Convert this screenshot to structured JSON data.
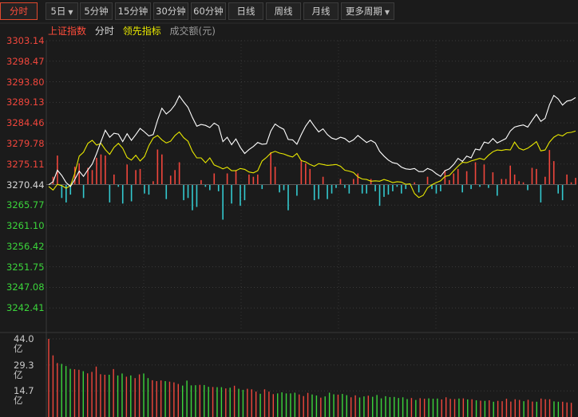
{
  "tabs": [
    {
      "label": "分时",
      "active": true
    },
    {
      "label": "5日",
      "dropdown": true
    },
    {
      "label": "5分钟"
    },
    {
      "label": "15分钟"
    },
    {
      "label": "30分钟"
    },
    {
      "label": "60分钟"
    },
    {
      "label": "日线"
    },
    {
      "label": "周线"
    },
    {
      "label": "月线"
    },
    {
      "label": "更多周期",
      "dropdown": true
    }
  ],
  "legend": {
    "index_name": "上证指数",
    "period": "分时",
    "indicator": "领先指标",
    "volume_label": "成交额(元)"
  },
  "colors": {
    "up": "#f0463c",
    "down": "#33c9cf",
    "price_line": "#ffffff",
    "avg_line": "#e8e800",
    "axis_up": "#f0463c",
    "axis_down": "#3bd53b",
    "active_tab": "#ff4c3b"
  },
  "chart_data": {
    "type": "line",
    "price_axis": {
      "labels": [
        "3303.14",
        "3298.47",
        "3293.80",
        "3289.13",
        "3284.46",
        "3279.78",
        "3275.11",
        "3270.44",
        "3265.77",
        "3261.10",
        "3256.42",
        "3251.75",
        "3247.08",
        "3242.41"
      ],
      "prev_close": "3270.44",
      "ylim": [
        3237.74,
        3303.14
      ]
    },
    "volume_axis": {
      "labels": [
        "44.0亿",
        "29.3亿",
        "14.7亿"
      ],
      "ylim": [
        0,
        44.0
      ]
    },
    "series": [
      {
        "key": "price",
        "values": [
          3270.4,
          3271.1,
          3273.7,
          3272.5,
          3270.9,
          3270.0,
          3271.6,
          3273.5,
          3272.3,
          3273.8,
          3275.1,
          3277.5,
          3280.2,
          3282.8,
          3281.2,
          3282.1,
          3281.9,
          3280.2,
          3282.0,
          3280.5,
          3281.8,
          3283.2,
          3282.4,
          3281.5,
          3281.8,
          3285.1,
          3287.8,
          3286.5,
          3287.3,
          3288.6,
          3290.6,
          3289.2,
          3288.0,
          3285.7,
          3283.7,
          3284.1,
          3283.9,
          3283.4,
          3284.4,
          3283.8,
          3280.2,
          3281.2,
          3279.5,
          3280.8,
          3278.9,
          3277.5,
          3278.4,
          3279.1,
          3280.0,
          3279.6,
          3279.7,
          3282.6,
          3284.2,
          3283.5,
          3283.0,
          3280.7,
          3280.6,
          3279.6,
          3281.8,
          3283.7,
          3285.1,
          3283.7,
          3282.4,
          3283.1,
          3281.8,
          3281.0,
          3280.7,
          3281.2,
          3280.9,
          3280.1,
          3280.6,
          3281.6,
          3280.8,
          3280.0,
          3280.5,
          3279.9,
          3278.0,
          3276.9,
          3276.0,
          3275.4,
          3275.2,
          3274.4,
          3274.0,
          3273.9,
          3274.1,
          3273.4,
          3273.4,
          3274.1,
          3273.7,
          3272.9,
          3272.3,
          3273.6,
          3274.0,
          3275.0,
          3276.4,
          3275.7,
          3276.9,
          3276.5,
          3278.5,
          3278.3,
          3280.1,
          3279.8,
          3280.9,
          3279.9,
          3280.4,
          3280.9,
          3282.6,
          3283.5,
          3283.8,
          3284.0,
          3283.5,
          3285.0,
          3286.4,
          3284.8,
          3285.5,
          3288.6,
          3290.7,
          3289.9,
          3288.5,
          3289.4,
          3289.6,
          3290.2
        ]
      },
      {
        "key": "leading",
        "values": [
          3270.0,
          3269.2,
          3270.5,
          3270.2,
          3269.6,
          3270.2,
          3273.0,
          3276.9,
          3277.8,
          3279.8,
          3280.5,
          3279.4,
          3279.8,
          3278.4,
          3277.3,
          3278.9,
          3279.8,
          3278.7,
          3276.6,
          3276.0,
          3277.1,
          3275.8,
          3276.8,
          3279.3,
          3281.0,
          3281.6,
          3280.6,
          3279.9,
          3280.3,
          3281.6,
          3282.4,
          3281.1,
          3280.3,
          3278.0,
          3276.5,
          3276.5,
          3275.4,
          3276.5,
          3274.9,
          3274.5,
          3274.0,
          3274.4,
          3273.6,
          3273.6,
          3274.1,
          3273.9,
          3273.3,
          3273.1,
          3273.6,
          3275.8,
          3276.6,
          3277.6,
          3278.0,
          3277.6,
          3277.4,
          3277.0,
          3276.7,
          3277.5,
          3275.9,
          3275.6,
          3275.0,
          3274.6,
          3275.2,
          3275.0,
          3274.8,
          3274.9,
          3275.0,
          3274.6,
          3273.7,
          3273.5,
          3273.2,
          3272.2,
          3271.7,
          3271.6,
          3271.2,
          3271.3,
          3271.2,
          3271.6,
          3271.3,
          3270.9,
          3271.1,
          3271.0,
          3270.5,
          3270.6,
          3268.4,
          3267.5,
          3268.0,
          3269.7,
          3270.4,
          3270.9,
          3271.3,
          3272.3,
          3272.5,
          3273.6,
          3274.6,
          3275.5,
          3275.4,
          3275.8,
          3276.1,
          3276.4,
          3276.1,
          3277.1,
          3277.9,
          3278.3,
          3278.2,
          3278.4,
          3278.3,
          3280.1,
          3278.7,
          3278.3,
          3278.7,
          3279.4,
          3280.2,
          3278.1,
          3278.3,
          3280.1,
          3281.2,
          3281.8,
          3281.5,
          3282.2,
          3282.3,
          3282.6
        ]
      }
    ],
    "volume_values": [
      44.0,
      34.7,
      30.4,
      29.9,
      28.7,
      27.1,
      26.9,
      26.6,
      25.8,
      24.6,
      25.4,
      28.4,
      24.1,
      23.8,
      23.8,
      27.0,
      23.4,
      24.5,
      22.7,
      23.4,
      21.9,
      24.0,
      24.5,
      21.9,
      20.7,
      20.2,
      20.6,
      20.2,
      19.9,
      19.5,
      18.6,
      17.7,
      20.5,
      17.8,
      17.9,
      18.1,
      18.0,
      17.0,
      16.9,
      16.8,
      16.8,
      16.1,
      16.5,
      17.6,
      15.9,
      15.3,
      15.9,
      15.6,
      14.3,
      13.1,
      15.6,
      14.3,
      12.9,
      13.3,
      13.9,
      13.3,
      13.3,
      13.7,
      12.7,
      11.8,
      13.6,
      12.7,
      12.1,
      10.9,
      11.6,
      13.7,
      12.8,
      12.6,
      13.0,
      12.3,
      11.1,
      12.2,
      11.0,
      11.6,
      12.0,
      11.4,
      12.4,
      10.5,
      11.7,
      11.2,
      11.3,
      10.7,
      11.1,
      10.1,
      10.7,
      9.6,
      10.6,
      10.3,
      10.5,
      10.3,
      10.4,
      9.9,
      11.1,
      10.2,
      10.1,
      10.4,
      10.5,
      9.9,
      10.0,
      9.4,
      9.2,
      9.1,
      9.4,
      8.6,
      9.1,
      8.9,
      10.3,
      8.7,
      10.0,
      9.6,
      8.9,
      9.7,
      8.7,
      8.6,
      10.4,
      10.0,
      10.0,
      8.8,
      8.6,
      8.6,
      8.2,
      8.0
    ],
    "grid": true
  }
}
